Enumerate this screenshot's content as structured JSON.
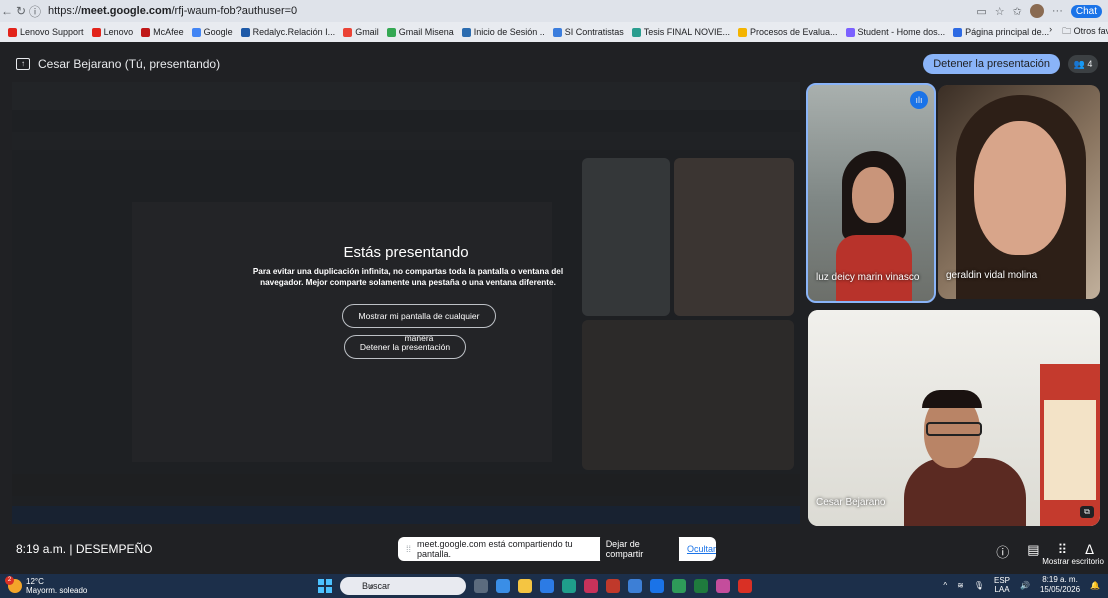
{
  "browser": {
    "url_prefix": "https://",
    "url_domain": "meet.google.com",
    "url_path": "/rfj-waum-fob?authuser=0",
    "chat_label": "Chat",
    "bookmarks": [
      {
        "label": "Lenovo Support",
        "color": "#e2231a"
      },
      {
        "label": "Lenovo",
        "color": "#e2231a"
      },
      {
        "label": "McAfee",
        "color": "#c01818"
      },
      {
        "label": "Google",
        "color": "#4285f4"
      },
      {
        "label": "Redalyc.Relación I...",
        "color": "#1e5aa8"
      },
      {
        "label": "Gmail",
        "color": "#ea4335"
      },
      {
        "label": "Gmail Misena",
        "color": "#34a853"
      },
      {
        "label": "Inicio de Sesión ..",
        "color": "#2b6cb0"
      },
      {
        "label": "SI Contratistas",
        "color": "#3b7ddd"
      },
      {
        "label": "Tesis FINAL NOVIE...",
        "color": "#2a9d8f"
      },
      {
        "label": "Procesos de Evalua...",
        "color": "#f4b400"
      },
      {
        "label": "Student - Home dos...",
        "color": "#7b61ff"
      },
      {
        "label": "Página principal de...",
        "color": "#2d6ae3"
      }
    ],
    "other_bookmarks": "Otros favoritos"
  },
  "meet": {
    "presenter_title": "Cesar Bejarano (Tú, presentando)",
    "stop_presenting_top": "Detener la presentación",
    "people_count": "4",
    "presenting": {
      "heading": "Estás presentando",
      "warning": "Para evitar una duplicación infinita, no compartas toda la pantalla o ventana del navegador. Mejor comparte solamente una pestaña o una ventana diferente.",
      "show_anyway": "Mostrar mi pantalla de cualquier manera",
      "stop_presenting": "Detener la presentación"
    },
    "participants": [
      {
        "name": "luz deicy marin vinasco"
      },
      {
        "name": "geraldin vidal molina"
      },
      {
        "name": "Cesar Bejarano"
      }
    ],
    "time": "8:19 a.m.",
    "meeting_name": "DESEMPEÑO",
    "share_notice": "meet.google.com está compartiendo tu pantalla.",
    "stop_sharing": "Dejar de compartir",
    "hide": "Ocultar",
    "tooltip": "Mostrar escritorio"
  },
  "taskbar": {
    "weather_temp": "12°C",
    "weather_desc": "Mayorm. soleado",
    "badge": "2",
    "search_placeholder": "Buscar",
    "lang": "ESP",
    "lang2": "LAA",
    "clock_time": "8:19 a. m.",
    "clock_date": "15/05/2026"
  }
}
